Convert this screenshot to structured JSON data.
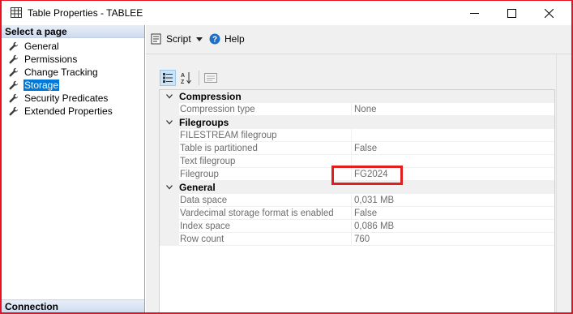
{
  "window": {
    "title": "Table Properties - TABLEE",
    "app_icon": "table-icon",
    "controls": [
      "minimize-icon",
      "maximize-icon",
      "close-icon"
    ],
    "accent_color": "#e81123"
  },
  "left_pane": {
    "header": "Select a page",
    "items": [
      {
        "label": "General",
        "icon": "wrench-icon",
        "selected": false
      },
      {
        "label": "Permissions",
        "icon": "wrench-icon",
        "selected": false
      },
      {
        "label": "Change Tracking",
        "icon": "wrench-icon",
        "selected": false
      },
      {
        "label": "Storage",
        "icon": "wrench-icon",
        "selected": true
      },
      {
        "label": "Security Predicates",
        "icon": "wrench-icon",
        "selected": false
      },
      {
        "label": "Extended Properties",
        "icon": "wrench-icon",
        "selected": false
      }
    ],
    "connection_header": "Connection",
    "selection_color": "#0078d7"
  },
  "toolbar": {
    "script_label": "Script",
    "help_label": "Help"
  },
  "property_grid": {
    "categories": [
      {
        "name": "Compression",
        "rows": [
          {
            "name": "Compression type",
            "value": "None"
          }
        ]
      },
      {
        "name": "Filegroups",
        "rows": [
          {
            "name": "FILESTREAM filegroup",
            "value": ""
          },
          {
            "name": "Table is partitioned",
            "value": "False"
          },
          {
            "name": "Text filegroup",
            "value": ""
          },
          {
            "name": "Filegroup",
            "value": "FG2024"
          }
        ]
      },
      {
        "name": "General",
        "rows": [
          {
            "name": "Data space",
            "value": "0,031 MB"
          },
          {
            "name": "Vardecimal storage format is enabled",
            "value": "False"
          },
          {
            "name": "Index space",
            "value": "0,086 MB"
          },
          {
            "name": "Row count",
            "value": "760"
          }
        ]
      }
    ],
    "highlight_color": "#e41d1d"
  }
}
